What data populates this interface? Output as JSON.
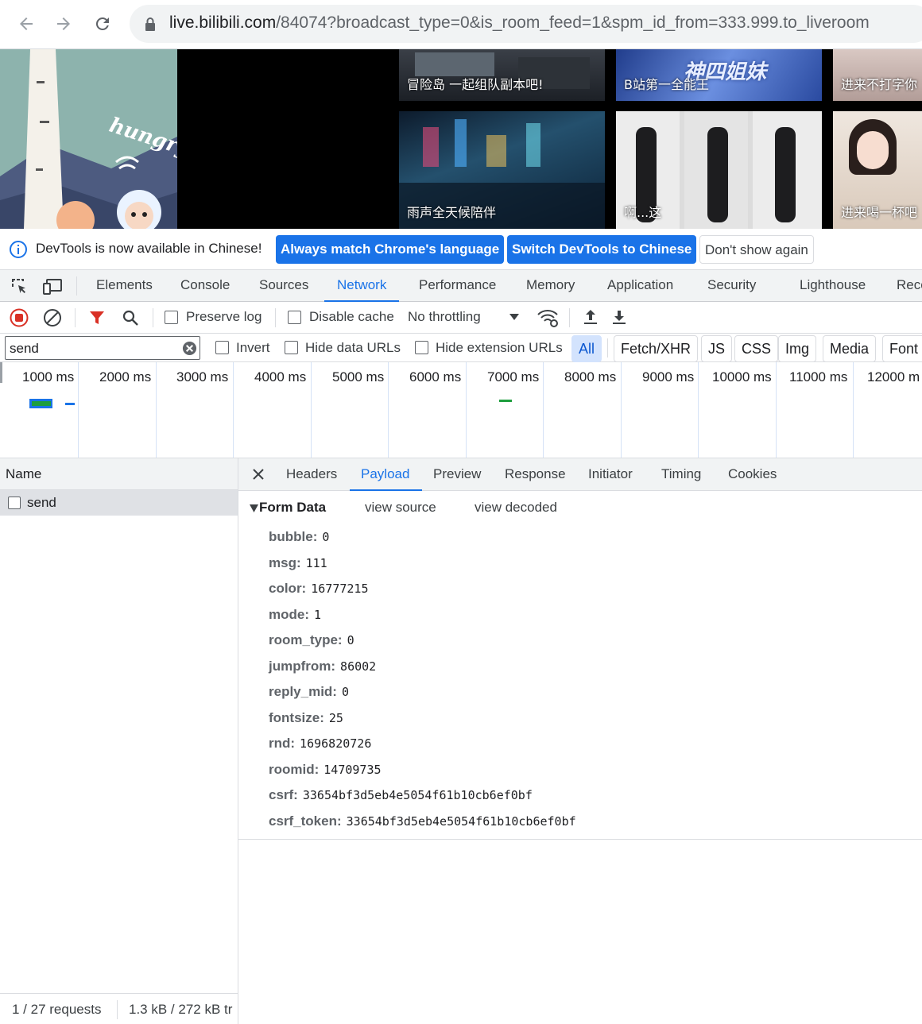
{
  "browser": {
    "url_host": "live.bilibili.com",
    "url_rest": "/84074?broadcast_type=0&is_room_feed=1&spm_id_from=333.999.to_liveroom"
  },
  "page": {
    "hungry_text": "hungry",
    "thumbs": [
      {
        "caption": "冒险岛 一起组队副本吧!"
      },
      {
        "caption": "B站第一全能王"
      },
      {
        "caption": "进来不打字你",
        "badge": "神四姐妹"
      },
      {
        "caption": "雨声全天候陪伴"
      },
      {
        "caption": "啊...这"
      },
      {
        "caption": "进来喝一杯吧"
      }
    ],
    "banner_overlay": "神四姐妹"
  },
  "infobar": {
    "message": "DevTools is now available in Chinese!",
    "btn_match": "Always match Chrome's language",
    "btn_switch": "Switch DevTools to Chinese",
    "btn_dismiss": "Don't show again"
  },
  "devtools": {
    "tabs": [
      "Elements",
      "Console",
      "Sources",
      "Network",
      "Performance",
      "Memory",
      "Application",
      "Security",
      "Lighthouse",
      "Reco"
    ],
    "active_tab": "Network",
    "toolbar": {
      "preserve_log": "Preserve log",
      "disable_cache": "Disable cache",
      "throttling": "No throttling"
    },
    "filter": {
      "value": "send",
      "invert": "Invert",
      "hide_data": "Hide data URLs",
      "hide_ext": "Hide extension URLs",
      "chips": [
        "All",
        "Fetch/XHR",
        "JS",
        "CSS",
        "Img",
        "Media",
        "Font"
      ],
      "active_chip": "All"
    },
    "timeline": {
      "ticks": [
        "1000 ms",
        "2000 ms",
        "3000 ms",
        "4000 ms",
        "5000 ms",
        "6000 ms",
        "7000 ms",
        "8000 ms",
        "9000 ms",
        "10000 ms",
        "11000 ms",
        "12000 m"
      ]
    },
    "requests": {
      "column": "Name",
      "rows": [
        {
          "name": "send"
        }
      ],
      "status_count": "1 / 27 requests",
      "status_size": "1.3 kB / 272 kB tr"
    },
    "detail": {
      "tabs": [
        "Headers",
        "Payload",
        "Preview",
        "Response",
        "Initiator",
        "Timing",
        "Cookies"
      ],
      "active": "Payload",
      "section": "Form Data",
      "view_source": "view source",
      "view_decoded": "view decoded",
      "fields": [
        {
          "key": "bubble:",
          "value": "0"
        },
        {
          "key": "msg:",
          "value": "111"
        },
        {
          "key": "color:",
          "value": "16777215"
        },
        {
          "key": "mode:",
          "value": "1"
        },
        {
          "key": "room_type:",
          "value": "0"
        },
        {
          "key": "jumpfrom:",
          "value": "86002"
        },
        {
          "key": "reply_mid:",
          "value": "0"
        },
        {
          "key": "fontsize:",
          "value": "25"
        },
        {
          "key": "rnd:",
          "value": "1696820726"
        },
        {
          "key": "roomid:",
          "value": "14709735"
        },
        {
          "key": "csrf:",
          "value": "33654bf3d5eb4e5054f61b10cb6ef0bf"
        },
        {
          "key": "csrf_token:",
          "value": "33654bf3d5eb4e5054f61b10cb6ef0bf"
        }
      ]
    }
  },
  "colors": {
    "accent": "#1a73e8",
    "record_red": "#d93025",
    "chip_active_bg": "#d3e3fd",
    "timeline_bar_green": "#1e9e3e",
    "timeline_bar_blue": "#1a73e8"
  }
}
